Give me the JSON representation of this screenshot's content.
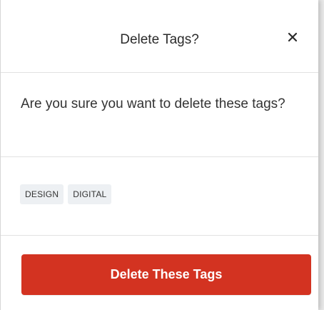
{
  "dialog": {
    "title": "Delete Tags?",
    "close_icon": "close-icon",
    "message": "Are you sure you want to delete these tags?",
    "tags": [
      "DESIGN",
      "DIGITAL"
    ],
    "confirm_label": "Delete These Tags"
  },
  "colors": {
    "danger": "#d33321",
    "tag_background": "#edf0f3",
    "divider": "#e2e2e2"
  }
}
